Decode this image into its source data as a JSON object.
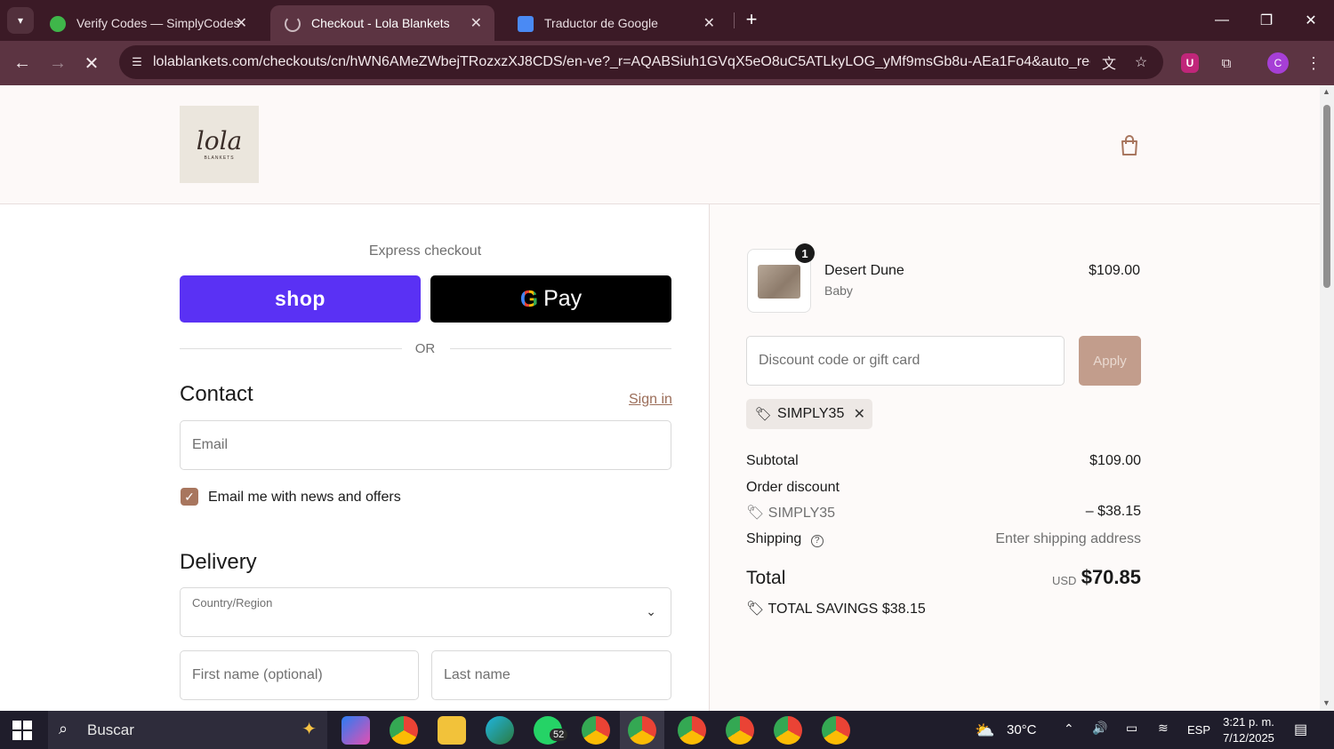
{
  "browser": {
    "tabs": [
      {
        "title": "Verify Codes — SimplyCodes",
        "active": false,
        "favicon": "simplycodes-icon"
      },
      {
        "title": "Checkout - Lola Blankets",
        "active": true,
        "favicon": "loading-icon"
      },
      {
        "title": "Traductor de Google",
        "active": false,
        "favicon": "google-translate-icon"
      }
    ],
    "url": "lolablankets.com/checkouts/cn/hWN6AMeZWbejTRozxzXJ8CDS/en-ve?_r=AQABSiuh1GVqX5eO8uC5ATLkyLOG_yMf9msGb8u-AEa1Fo4&auto_redirect=fa...",
    "profile_initial": "C",
    "extension_initial": "U"
  },
  "store": {
    "logo_script": "lola",
    "logo_sub": "BLANKETS"
  },
  "checkout": {
    "express_title": "Express checkout",
    "shop_label": "shop",
    "gpay_g": "G",
    "gpay_label": "Pay",
    "or_label": "OR",
    "contact_title": "Contact",
    "sign_in": "Sign in",
    "email_placeholder": "Email",
    "newsletter_label": "Email me with news and offers",
    "newsletter_checked": true,
    "delivery_title": "Delivery",
    "country_label": "Country/Region",
    "first_name_placeholder": "First name (optional)",
    "last_name_placeholder": "Last name"
  },
  "summary": {
    "item": {
      "name": "Desert Dune",
      "variant": "Baby",
      "price": "$109.00",
      "quantity": "1"
    },
    "discount_placeholder": "Discount code or gift card",
    "apply_label": "Apply",
    "applied_code": "SIMPLY35",
    "subtotal_label": "Subtotal",
    "subtotal_value": "$109.00",
    "order_discount_label": "Order discount",
    "discount_code": "SIMPLY35",
    "discount_value": "– $38.15",
    "shipping_label": "Shipping",
    "shipping_value": "Enter shipping address",
    "total_label": "Total",
    "currency": "USD",
    "total_value": "$70.85",
    "savings_label": "TOTAL SAVINGS",
    "savings_value": "$38.15"
  },
  "taskbar": {
    "search_label": "Buscar",
    "whatsapp_badge": "52",
    "weather": "30°C",
    "language": "ESP",
    "time": "3:21 p. m.",
    "date": "7/12/2025"
  },
  "colors": {
    "shop_purple": "#5a31f4",
    "accent_brown": "#a8765e",
    "tab_bar": "#3b1a26"
  }
}
